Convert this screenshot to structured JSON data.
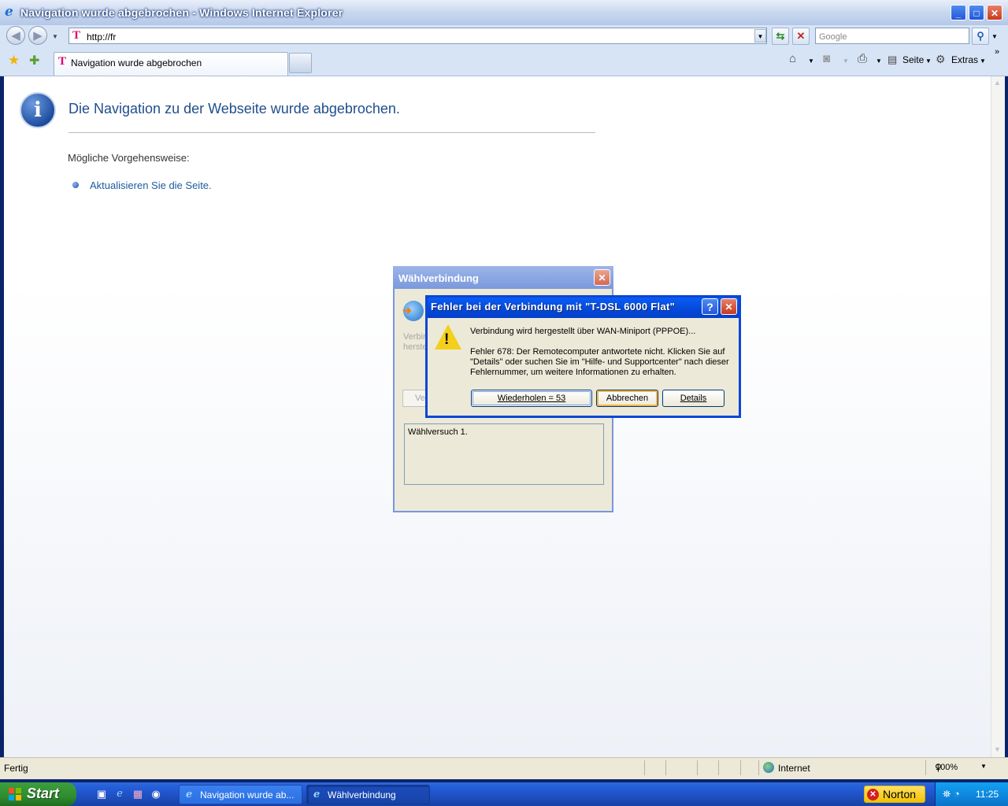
{
  "window": {
    "title": "Navigation wurde abgebrochen - Windows Internet Explorer",
    "controls": {
      "minimize": "_",
      "maximize": "□",
      "close": "✕"
    }
  },
  "toolbar": {
    "address": "http://fr",
    "search_placeholder": "Google",
    "refresh_icon": "refresh-icon",
    "stop_icon": "stop-icon"
  },
  "tabs": {
    "active_label": "Navigation wurde abgebrochen"
  },
  "command_bar": {
    "page_label": "Seite",
    "tools_label": "Extras"
  },
  "page": {
    "heading": "Die Navigation zu der Webseite wurde abgebrochen.",
    "possible_label": "Mögliche Vorgehensweise:",
    "refresh_link": "Aktualisieren Sie die Seite."
  },
  "dialer_dialog": {
    "title": "Wählverbindung",
    "status_line1": "Verbin",
    "status_line2": "herste",
    "button_partial": "Ve",
    "log_text": "Wählversuch 1."
  },
  "error_dialog": {
    "title": "Fehler bei der Verbindung mit \"T-DSL 6000 Flat\"",
    "line1": "Verbindung wird hergestellt über WAN-Miniport (PPPOE)...",
    "line2": "Fehler 678: Der Remotecomputer antwortete nicht. Klicken Sie auf",
    "line3": "\"Details\" oder suchen Sie im \"Hilfe- und Supportcenter\" nach dieser",
    "line4": "Fehlernummer, um weitere Informationen zu erhalten.",
    "retry_button": "Wiederholen = 53",
    "cancel_button": "Abbrechen",
    "details_button": "Details",
    "help_button": "?"
  },
  "statusbar": {
    "status": "Fertig",
    "zone": "Internet",
    "zoom": "100%"
  },
  "taskbar": {
    "start": "Start",
    "tasks": [
      "Navigation wurde ab...",
      "Wählverbindung"
    ],
    "norton": "Norton",
    "clock": "11:25"
  }
}
